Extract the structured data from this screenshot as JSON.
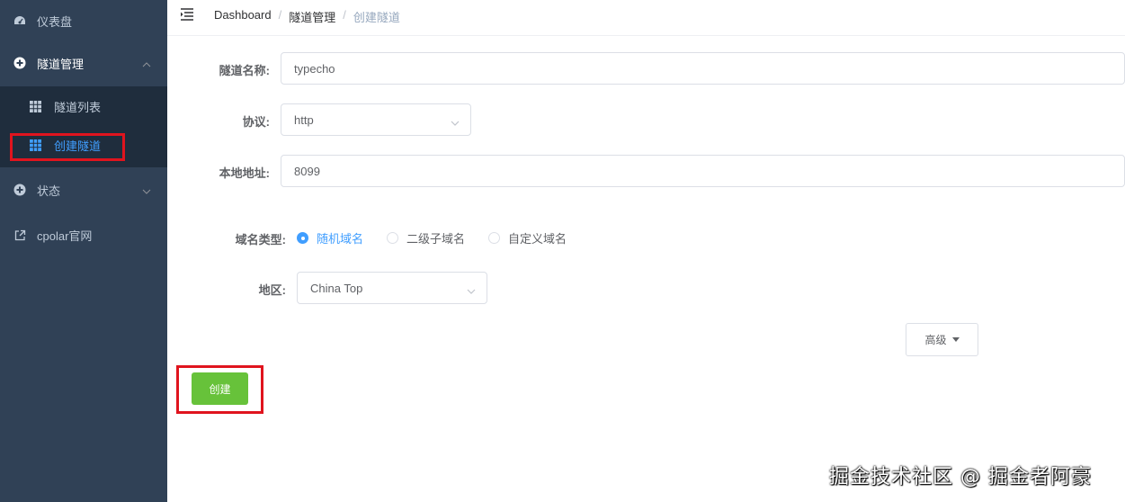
{
  "sidebar": {
    "dashboard": {
      "label": "仪表盘",
      "icon": "dashboard-icon"
    },
    "tunnel_mgmt": {
      "label": "隧道管理",
      "icon": "plus-circle-icon",
      "expanded": true
    },
    "tunnel_list": {
      "label": "隧道列表",
      "icon": "grid-icon"
    },
    "create_tunnel": {
      "label": "创建隧道",
      "icon": "grid-icon",
      "active": true
    },
    "status": {
      "label": "状态",
      "icon": "plus-circle-icon"
    },
    "cpolar_site": {
      "label": "cpolar官网",
      "icon": "external-link-icon"
    }
  },
  "breadcrumb": {
    "home": "Dashboard",
    "section": "隧道管理",
    "current": "创建隧道"
  },
  "form": {
    "name_label": "隧道名称:",
    "name_value": "typecho",
    "protocol_label": "协议:",
    "protocol_value": "http",
    "local_label": "本地地址:",
    "local_value": "8099",
    "domain_type_label": "域名类型:",
    "domain_options": [
      "随机域名",
      "二级子域名",
      "自定义域名"
    ],
    "domain_selected": "随机域名",
    "region_label": "地区:",
    "region_value": "China Top",
    "advanced_label": "高级",
    "create_label": "创建"
  },
  "watermark": "掘金技术社区 @ 掘金者阿豪",
  "colors": {
    "sidebar_bg": "#304156",
    "submenu_bg": "#1f2d3d",
    "accent": "#409eff",
    "create_btn": "#67c23a",
    "highlight_box": "#e0141e"
  }
}
